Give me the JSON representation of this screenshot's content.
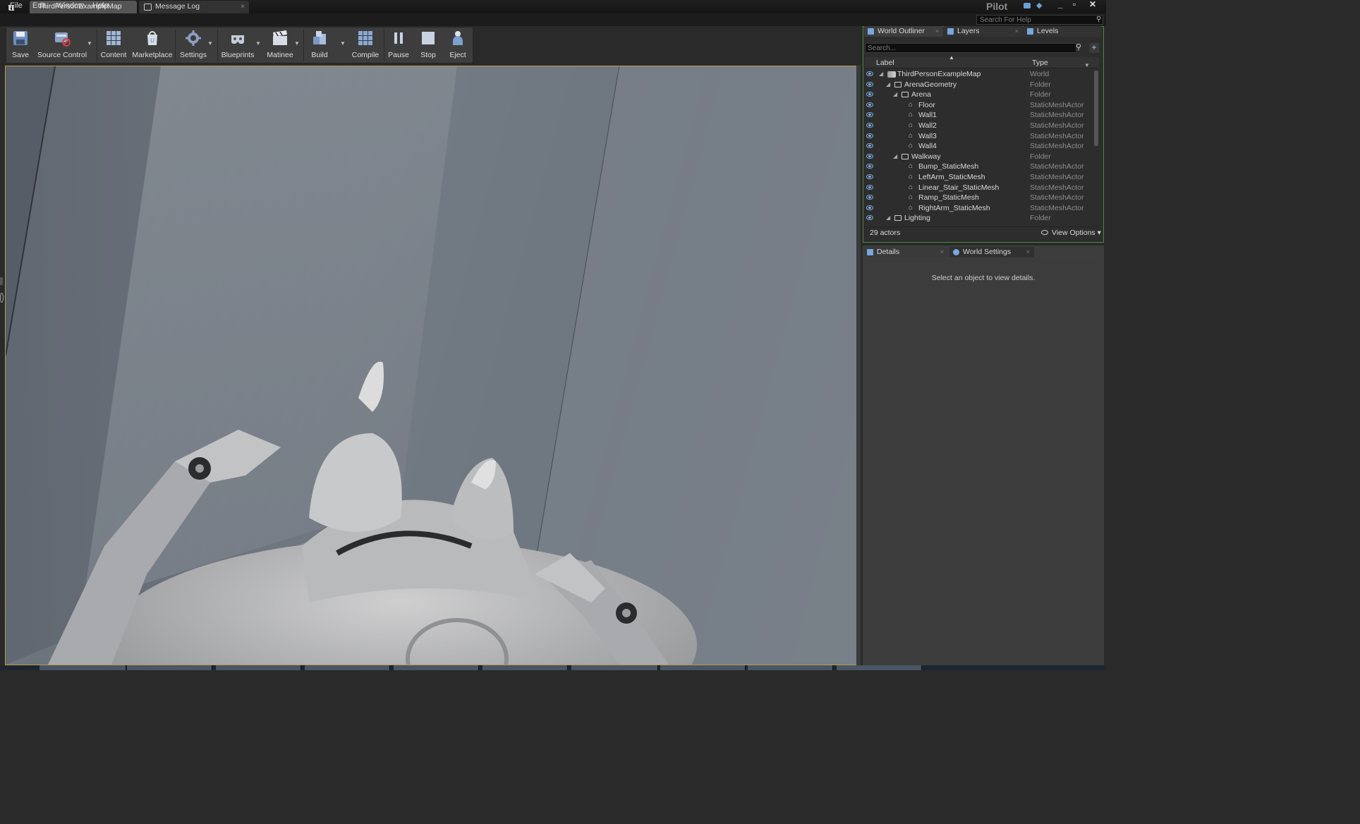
{
  "titlebar": {
    "tabs": [
      {
        "label": "ThirdPersonExampleMap",
        "active": true
      },
      {
        "label": "Message Log",
        "active": false
      }
    ],
    "project_name": "Pilot",
    "help_search_placeholder": "Search For Help",
    "window_controls": [
      "minimize",
      "maximize",
      "close"
    ]
  },
  "menu": {
    "items": [
      "File",
      "Edit",
      "Window",
      "Help"
    ]
  },
  "toolbar": {
    "buttons": [
      {
        "label": "Save",
        "icon": "save-icon"
      },
      {
        "label": "Source Control",
        "icon": "source-control-icon"
      },
      {
        "label": "Content",
        "icon": "content-icon"
      },
      {
        "label": "Marketplace",
        "icon": "marketplace-icon"
      },
      {
        "label": "Settings",
        "icon": "settings-icon"
      },
      {
        "label": "Blueprints",
        "icon": "blueprints-icon"
      },
      {
        "label": "Matinee",
        "icon": "matinee-icon"
      },
      {
        "label": "Build",
        "icon": "build-icon"
      },
      {
        "label": "Compile",
        "icon": "compile-icon"
      },
      {
        "label": "Pause",
        "icon": "pause-icon"
      },
      {
        "label": "Stop",
        "icon": "stop-icon"
      },
      {
        "label": "Eject",
        "icon": "eject-icon"
      }
    ]
  },
  "outliner": {
    "tabs": [
      "World Outliner",
      "Layers",
      "Levels"
    ],
    "search_placeholder": "Search...",
    "columns": {
      "label": "Label",
      "type": "Type"
    },
    "rows": [
      {
        "name": "ThirdPersonExampleMap",
        "type": "World",
        "depth": 0,
        "kind": "world"
      },
      {
        "name": "ArenaGeometry",
        "type": "Folder",
        "depth": 1,
        "kind": "folder"
      },
      {
        "name": "Arena",
        "type": "Folder",
        "depth": 2,
        "kind": "folder"
      },
      {
        "name": "Floor",
        "type": "StaticMeshActor",
        "depth": 3,
        "kind": "mesh"
      },
      {
        "name": "Wall1",
        "type": "StaticMeshActor",
        "depth": 3,
        "kind": "mesh"
      },
      {
        "name": "Wall2",
        "type": "StaticMeshActor",
        "depth": 3,
        "kind": "mesh"
      },
      {
        "name": "Wall3",
        "type": "StaticMeshActor",
        "depth": 3,
        "kind": "mesh"
      },
      {
        "name": "Wall4",
        "type": "StaticMeshActor",
        "depth": 3,
        "kind": "mesh"
      },
      {
        "name": "Walkway",
        "type": "Folder",
        "depth": 2,
        "kind": "folder"
      },
      {
        "name": "Bump_StaticMesh",
        "type": "StaticMeshActor",
        "depth": 3,
        "kind": "mesh"
      },
      {
        "name": "LeftArm_StaticMesh",
        "type": "StaticMeshActor",
        "depth": 3,
        "kind": "mesh"
      },
      {
        "name": "Linear_Stair_StaticMesh",
        "type": "StaticMeshActor",
        "depth": 3,
        "kind": "mesh"
      },
      {
        "name": "Ramp_StaticMesh",
        "type": "StaticMeshActor",
        "depth": 3,
        "kind": "mesh"
      },
      {
        "name": "RightArm_StaticMesh",
        "type": "StaticMeshActor",
        "depth": 3,
        "kind": "mesh"
      },
      {
        "name": "Lighting",
        "type": "Folder",
        "depth": 1,
        "kind": "folder"
      }
    ],
    "actor_count": "29 actors",
    "view_options": "View Options"
  },
  "details": {
    "tabs": [
      "Details",
      "World Settings"
    ],
    "empty_message": "Select an object to view details."
  },
  "colors": {
    "viewport_border": "#b79a42",
    "outliner_border": "#4a8a3a",
    "accent_blue": "#7fb4e6"
  }
}
